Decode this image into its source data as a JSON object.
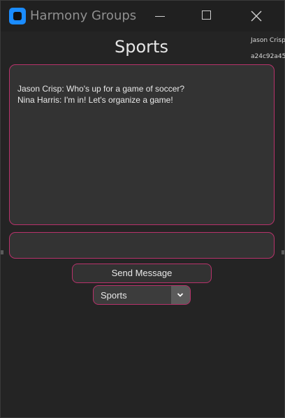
{
  "window": {
    "title": "Harmony Groups",
    "icon": "app-icon"
  },
  "header": {
    "group_name": "Sports",
    "user_name": "Jason Crisp",
    "user_id": "a24c92a45"
  },
  "chat": {
    "messages": [
      "Jason Crisp: Who's up for a game of soccer?",
      "Nina Harris: I'm in! Let's organize a game!"
    ]
  },
  "composer": {
    "value": "",
    "placeholder": "",
    "send_label": "Send Message"
  },
  "group_select": {
    "selected": "Sports"
  },
  "colors": {
    "accent_border": "#b8326b",
    "background": "#242424",
    "panel": "#333333"
  }
}
